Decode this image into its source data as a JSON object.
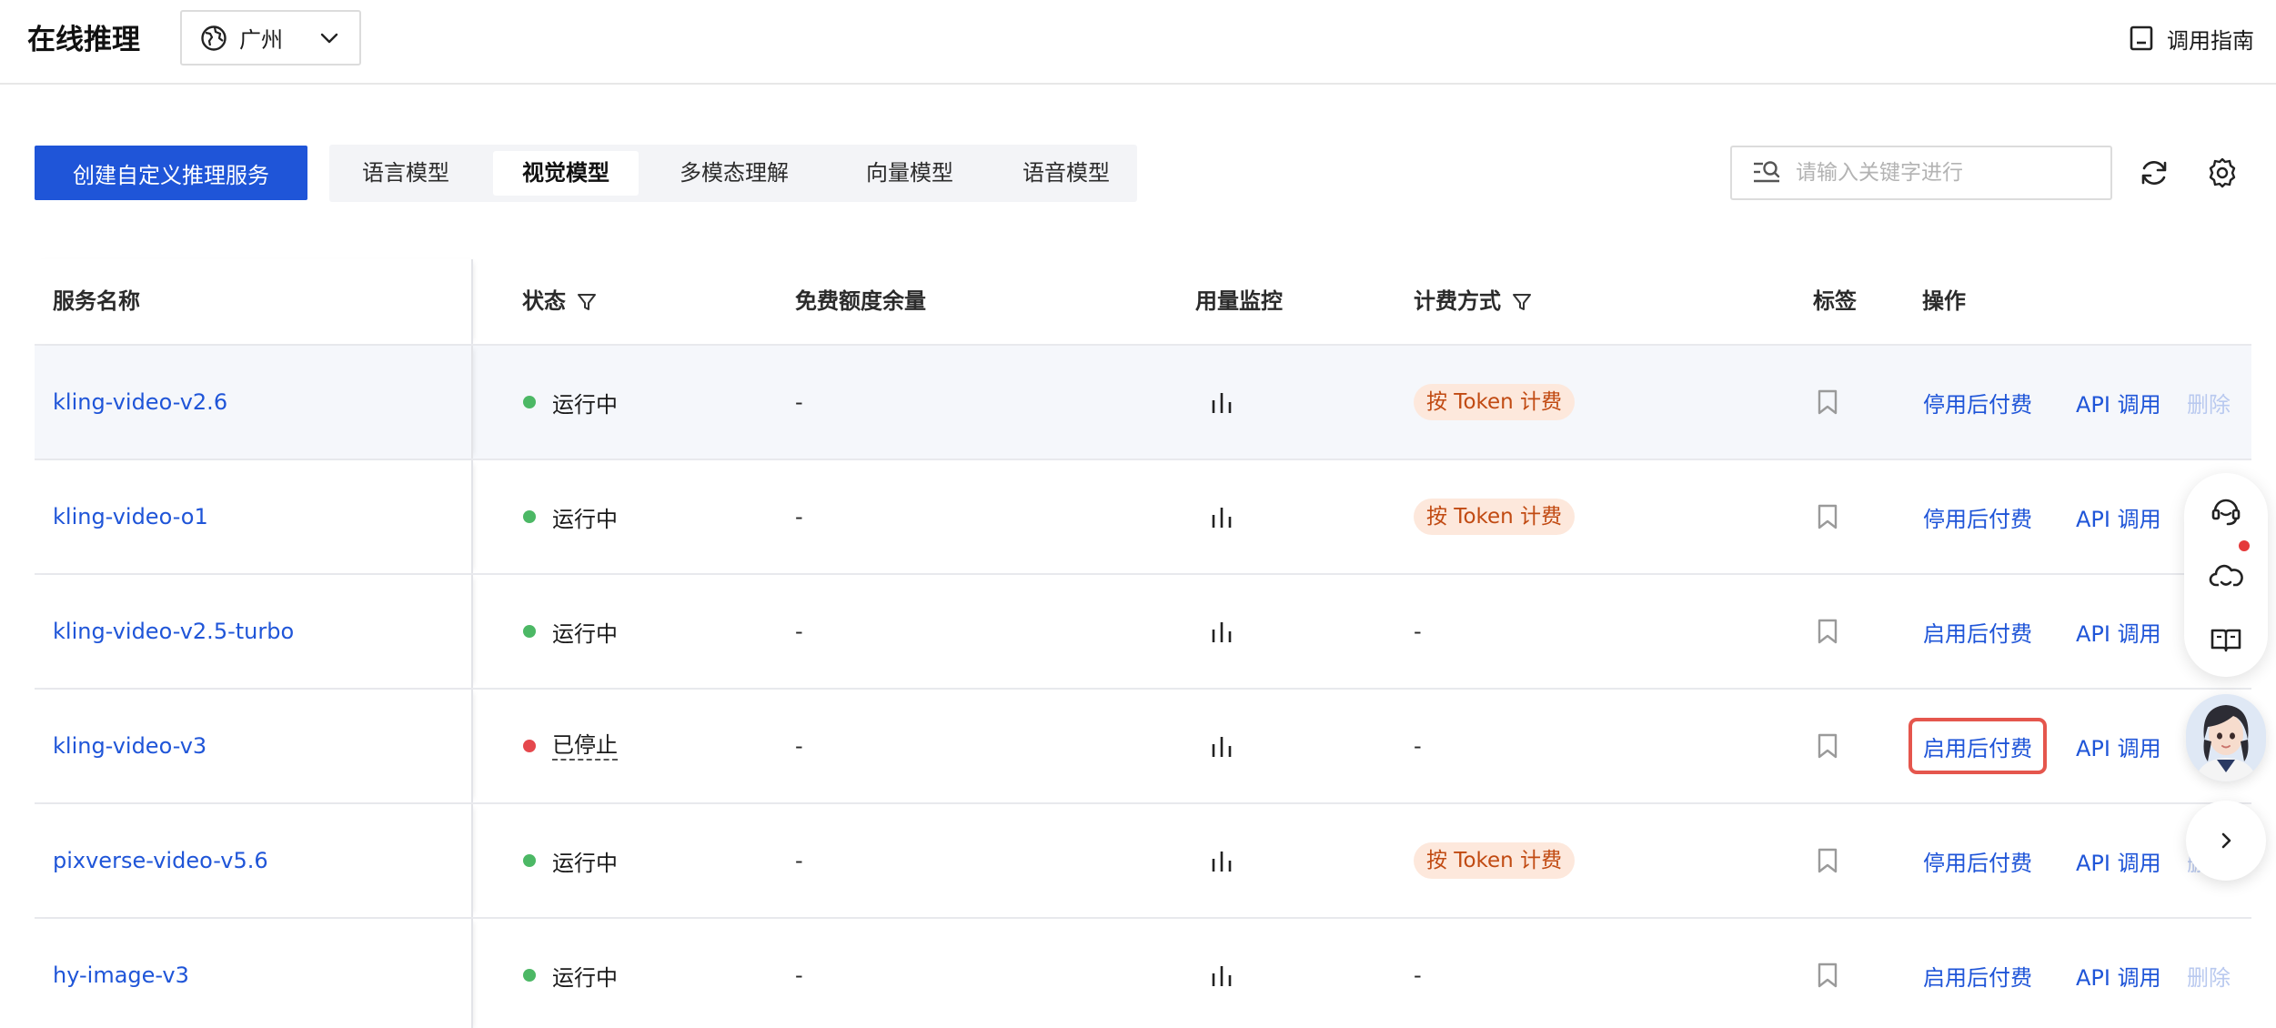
{
  "header": {
    "title": "在线推理",
    "region": "广州",
    "guide_label": "调用指南"
  },
  "toolbar": {
    "create_label": "创建自定义推理服务",
    "tabs": [
      {
        "label": "语言模型",
        "active": false
      },
      {
        "label": "视觉模型",
        "active": true
      },
      {
        "label": "多模态理解",
        "active": false
      },
      {
        "label": "向量模型",
        "active": false
      },
      {
        "label": "语音模型",
        "active": false
      }
    ],
    "search_placeholder": "请输入关键字进行",
    "icons": [
      "refresh-icon",
      "settings-icon"
    ]
  },
  "table": {
    "columns": {
      "name": "服务名称",
      "status": "状态",
      "free_quota": "免费额度余量",
      "usage": "用量监控",
      "billing": "计费方式",
      "tags": "标签",
      "actions": "操作"
    },
    "rows": [
      {
        "name": "kling-video-v2.6",
        "status": "运行中",
        "status_color": "#4cb865",
        "quota": "-",
        "billing": "按 Token 计费",
        "billing_badge": true,
        "action": "停用后付费",
        "api": "API 调用",
        "delete": "删除"
      },
      {
        "name": "kling-video-o1",
        "status": "运行中",
        "status_color": "#4cb865",
        "quota": "-",
        "billing": "按 Token 计费",
        "billing_badge": true,
        "action": "停用后付费",
        "api": "API 调用",
        "delete": ""
      },
      {
        "name": "kling-video-v2.5-turbo",
        "status": "运行中",
        "status_color": "#4cb865",
        "quota": "-",
        "billing": "-",
        "billing_badge": false,
        "action": "启用后付费",
        "api": "API 调用",
        "delete": ""
      },
      {
        "name": "kling-video-v3",
        "status": "已停止",
        "status_color": "#e5484d",
        "quota": "-",
        "billing": "-",
        "billing_badge": false,
        "action": "启用后付费",
        "api": "API 调用",
        "delete": ""
      },
      {
        "name": "pixverse-video-v5.6",
        "status": "运行中",
        "status_color": "#4cb865",
        "quota": "-",
        "billing": "按 Token 计费",
        "billing_badge": true,
        "action": "停用后付费",
        "api": "API 调用",
        "delete": "删"
      },
      {
        "name": "hy-image-v3",
        "status": "运行中",
        "status_color": "#4cb865",
        "quota": "-",
        "billing": "-",
        "billing_badge": false,
        "action": "启用后付费",
        "api": "API 调用",
        "delete": "删除"
      }
    ],
    "hover_row": 0,
    "highlight_row": 3
  },
  "colors": {
    "primary": "#1f55d8",
    "running": "#4cb865",
    "stopped": "#e5484d",
    "badge_bg": "#fde8dc",
    "badge_text": "#c14a12",
    "highlight": "#e5564d"
  },
  "float_panel": {
    "icons": [
      "customer-service-icon",
      "cloud-message-icon",
      "docs-book-icon",
      "assistant-avatar",
      "chevron-right-icon"
    ]
  }
}
